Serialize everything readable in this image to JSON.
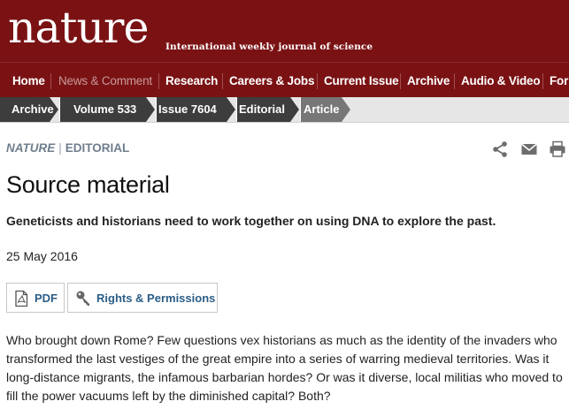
{
  "masthead": {
    "logo": "nature",
    "tagline": "International weekly journal of science"
  },
  "nav": {
    "items": [
      {
        "label": "Home"
      },
      {
        "label": "News & Comment"
      },
      {
        "label": "Research"
      },
      {
        "label": "Careers & Jobs"
      },
      {
        "label": "Current Issue"
      },
      {
        "label": "Archive"
      },
      {
        "label": "Audio & Video"
      },
      {
        "label": "For"
      }
    ]
  },
  "breadcrumb": {
    "items": [
      {
        "label": "Archive"
      },
      {
        "label": "Volume 533"
      },
      {
        "label": "Issue 7604"
      },
      {
        "label": "Editorial"
      },
      {
        "label": "Article"
      }
    ]
  },
  "article": {
    "journal": "NATURE",
    "separator": "|",
    "section": "EDITORIAL",
    "title": "Source material",
    "standfirst": "Geneticists and historians need to work together on using DNA to explore the past.",
    "date": "25 May 2016",
    "pdf_label": "PDF",
    "rights_label": "Rights & Permissions",
    "body": "Who brought down Rome? Few questions vex historians as much as the identity of the invaders who transformed the last vestiges of the great empire into a series of warring medieval territories. Was it long-distance migrants, the infamous barbarian hordes? Or was it diverse, local militias who moved to fill the power vacuums left by the diminished capital? Both?"
  },
  "icons": {
    "share": "share-icon",
    "email": "email-icon",
    "print": "print-icon",
    "pdf": "pdf-document-icon",
    "rights": "key-icon"
  },
  "colors": {
    "brand": "#7a1214",
    "link": "#2b5d86",
    "breadcrumb_dark": "#3d3d3d",
    "breadcrumb_active": "#777777"
  }
}
